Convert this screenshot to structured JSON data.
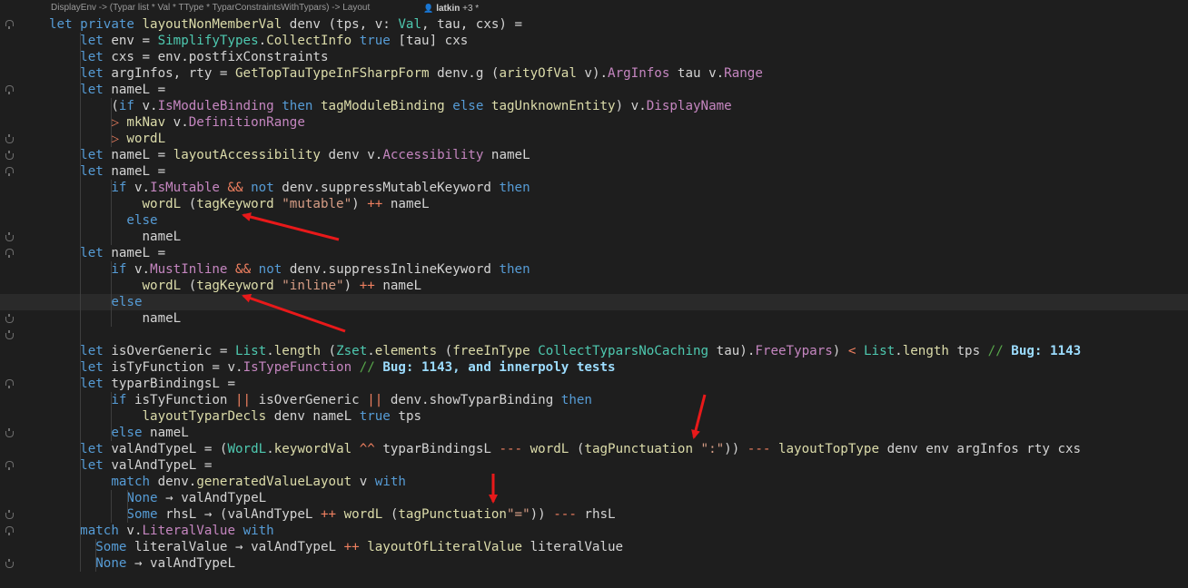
{
  "header": {
    "signature": "DisplayEnv -> (Typar list * Val * TType * TyparConstraintsWithTypars) -> Layout",
    "author": "latkin",
    "author_extra": "+3 *"
  },
  "colors": {
    "background": "#1e1e1e",
    "keyword": "#569cd6",
    "function": "#dcdcaa",
    "type": "#4ec9b0",
    "string": "#d69d85",
    "operator": "#f08060",
    "comment": "#57a64a",
    "arrow": "#e8191a"
  },
  "code_lines": [
    [
      [
        "kw",
        "let private "
      ],
      [
        "fn",
        "layoutNonMemberVal "
      ],
      [
        "pl",
        "denv (tps, v: "
      ],
      [
        "ty",
        "Val"
      ],
      [
        "pl",
        ", tau, cxs) ="
      ]
    ],
    [
      [
        "kw",
        "    let "
      ],
      [
        "pl",
        "env = "
      ],
      [
        "ty",
        "SimplifyTypes"
      ],
      [
        "pl",
        "."
      ],
      [
        "fn",
        "CollectInfo "
      ],
      [
        "kw",
        "true "
      ],
      [
        "pl",
        "[tau] cxs"
      ]
    ],
    [
      [
        "kw",
        "    let "
      ],
      [
        "pl",
        "cxs = env.postfixConstraints"
      ]
    ],
    [
      [
        "kw",
        "    let "
      ],
      [
        "pl",
        "argInfos, rty = "
      ],
      [
        "fn",
        "GetTopTauTypeInFSharpForm "
      ],
      [
        "pl",
        "denv.g ("
      ],
      [
        "fn",
        "arityOfVal "
      ],
      [
        "pl",
        "v)."
      ],
      [
        "ng",
        "ArgInfos "
      ],
      [
        "pl",
        "tau v."
      ],
      [
        "ng",
        "Range"
      ]
    ],
    [
      [
        "kw",
        "    let "
      ],
      [
        "pl",
        "nameL ="
      ]
    ],
    [
      [
        "pl",
        "        ("
      ],
      [
        "kw",
        "if "
      ],
      [
        "pl",
        "v."
      ],
      [
        "ng",
        "IsModuleBinding "
      ],
      [
        "kw",
        "then "
      ],
      [
        "fn",
        "tagModuleBinding "
      ],
      [
        "kw",
        "else "
      ],
      [
        "fn",
        "tagUnknownEntity"
      ],
      [
        "pl",
        ") v."
      ],
      [
        "ng",
        "DisplayName"
      ]
    ],
    [
      [
        "op",
        "        ▷ "
      ],
      [
        "fn",
        "mkNav "
      ],
      [
        "pl",
        "v."
      ],
      [
        "ng",
        "DefinitionRange"
      ]
    ],
    [
      [
        "op",
        "        ▷ "
      ],
      [
        "fn",
        "wordL"
      ]
    ],
    [
      [
        "kw",
        "    let "
      ],
      [
        "pl",
        "nameL = "
      ],
      [
        "fn",
        "layoutAccessibility "
      ],
      [
        "pl",
        "denv v."
      ],
      [
        "ng",
        "Accessibility "
      ],
      [
        "pl",
        "nameL"
      ]
    ],
    [
      [
        "kw",
        "    let "
      ],
      [
        "pl",
        "nameL ="
      ]
    ],
    [
      [
        "kw",
        "        if "
      ],
      [
        "pl",
        "v."
      ],
      [
        "ng",
        "IsMutable "
      ],
      [
        "op",
        "&& "
      ],
      [
        "kw",
        "not "
      ],
      [
        "pl",
        "denv.suppressMutableKeyword "
      ],
      [
        "kw",
        "then"
      ]
    ],
    [
      [
        "fn",
        "            wordL "
      ],
      [
        "pl",
        "("
      ],
      [
        "fn",
        "tagKeyword "
      ],
      [
        "str",
        "\"mutable\""
      ],
      [
        "pl",
        ") "
      ],
      [
        "op",
        "++ "
      ],
      [
        "pl",
        "nameL"
      ]
    ],
    [
      [
        "kw",
        "          else"
      ]
    ],
    [
      [
        "pl",
        "            nameL"
      ]
    ],
    [
      [
        "kw",
        "    let "
      ],
      [
        "pl",
        "nameL ="
      ]
    ],
    [
      [
        "kw",
        "        if "
      ],
      [
        "pl",
        "v."
      ],
      [
        "ng",
        "MustInline "
      ],
      [
        "op",
        "&& "
      ],
      [
        "kw",
        "not "
      ],
      [
        "pl",
        "denv.suppressInlineKeyword "
      ],
      [
        "kw",
        "then"
      ]
    ],
    [
      [
        "fn",
        "            wordL "
      ],
      [
        "pl",
        "("
      ],
      [
        "fn",
        "tagKeyword "
      ],
      [
        "str",
        "\"inline\""
      ],
      [
        "pl",
        ") "
      ],
      [
        "op",
        "++ "
      ],
      [
        "pl",
        "nameL"
      ]
    ],
    [
      [
        "kw",
        "        else"
      ]
    ],
    [
      [
        "pl",
        "            nameL"
      ]
    ],
    [
      [
        "pl",
        ""
      ]
    ],
    [
      [
        "kw",
        "    let "
      ],
      [
        "pl",
        "isOverGeneric = "
      ],
      [
        "ty",
        "List"
      ],
      [
        "pl",
        "."
      ],
      [
        "fn",
        "length "
      ],
      [
        "pl",
        "("
      ],
      [
        "ty",
        "Zset"
      ],
      [
        "pl",
        "."
      ],
      [
        "fn",
        "elements "
      ],
      [
        "pl",
        "("
      ],
      [
        "fn",
        "freeInType "
      ],
      [
        "ty",
        "CollectTyparsNoCaching "
      ],
      [
        "pl",
        "tau)."
      ],
      [
        "ng",
        "FreeTypars"
      ],
      [
        "pl",
        ") "
      ],
      [
        "op",
        "< "
      ],
      [
        "ty",
        "List"
      ],
      [
        "pl",
        "."
      ],
      [
        "fn",
        "length "
      ],
      [
        "pl",
        "tps "
      ],
      [
        "cm",
        "// "
      ],
      [
        "cmk",
        "Bug: 1143"
      ]
    ],
    [
      [
        "kw",
        "    let "
      ],
      [
        "pl",
        "isTyFunction = v."
      ],
      [
        "ng",
        "IsTypeFunction "
      ],
      [
        "cm",
        "// "
      ],
      [
        "cmk",
        "Bug: 1143, and innerpoly tests"
      ]
    ],
    [
      [
        "kw",
        "    let "
      ],
      [
        "pl",
        "typarBindingsL ="
      ]
    ],
    [
      [
        "kw",
        "        if "
      ],
      [
        "pl",
        "isTyFunction "
      ],
      [
        "op",
        "|| "
      ],
      [
        "pl",
        "isOverGeneric "
      ],
      [
        "op",
        "|| "
      ],
      [
        "pl",
        "denv.showTyparBinding "
      ],
      [
        "kw",
        "then"
      ]
    ],
    [
      [
        "fn",
        "            layoutTyparDecls "
      ],
      [
        "pl",
        "denv nameL "
      ],
      [
        "kw",
        "true "
      ],
      [
        "pl",
        "tps"
      ]
    ],
    [
      [
        "kw",
        "        else "
      ],
      [
        "pl",
        "nameL"
      ]
    ],
    [
      [
        "kw",
        "    let "
      ],
      [
        "pl",
        "valAndTypeL = ("
      ],
      [
        "ty",
        "WordL"
      ],
      [
        "pl",
        "."
      ],
      [
        "fn",
        "keywordVal "
      ],
      [
        "op",
        "^^ "
      ],
      [
        "pl",
        "typarBindingsL "
      ],
      [
        "op",
        "--- "
      ],
      [
        "fn",
        "wordL "
      ],
      [
        "pl",
        "("
      ],
      [
        "fn",
        "tagPunctuation "
      ],
      [
        "str",
        "\":\""
      ],
      [
        "pl",
        ")) "
      ],
      [
        "op",
        "--- "
      ],
      [
        "fn",
        "layoutTopType "
      ],
      [
        "pl",
        "denv env argInfos rty cxs"
      ]
    ],
    [
      [
        "kw",
        "    let "
      ],
      [
        "pl",
        "valAndTypeL ="
      ]
    ],
    [
      [
        "kw",
        "        match "
      ],
      [
        "pl",
        "denv."
      ],
      [
        "fn",
        "generatedValueLayout "
      ],
      [
        "pl",
        "v "
      ],
      [
        "kw",
        "with"
      ]
    ],
    [
      [
        "kw",
        "          None "
      ],
      [
        "pl",
        "→ valAndTypeL"
      ]
    ],
    [
      [
        "kw",
        "          Some "
      ],
      [
        "pl",
        "rhsL → (valAndTypeL "
      ],
      [
        "op",
        "++ "
      ],
      [
        "fn",
        "wordL "
      ],
      [
        "pl",
        "("
      ],
      [
        "fn",
        "tagPunctuation"
      ],
      [
        "str",
        "\"=\""
      ],
      [
        "pl",
        ")) "
      ],
      [
        "op",
        "--- "
      ],
      [
        "pl",
        "rhsL"
      ]
    ],
    [
      [
        "kw",
        "    match "
      ],
      [
        "pl",
        "v."
      ],
      [
        "ng",
        "LiteralValue "
      ],
      [
        "kw",
        "with"
      ]
    ],
    [
      [
        "kw",
        "      Some "
      ],
      [
        "pl",
        "literalValue → valAndTypeL "
      ],
      [
        "op",
        "++ "
      ],
      [
        "fn",
        "layoutOfLiteralValue "
      ],
      [
        "pl",
        "literalValue"
      ]
    ],
    [
      [
        "kw",
        "      None "
      ],
      [
        "pl",
        "→ valAndTypeL"
      ]
    ]
  ]
}
